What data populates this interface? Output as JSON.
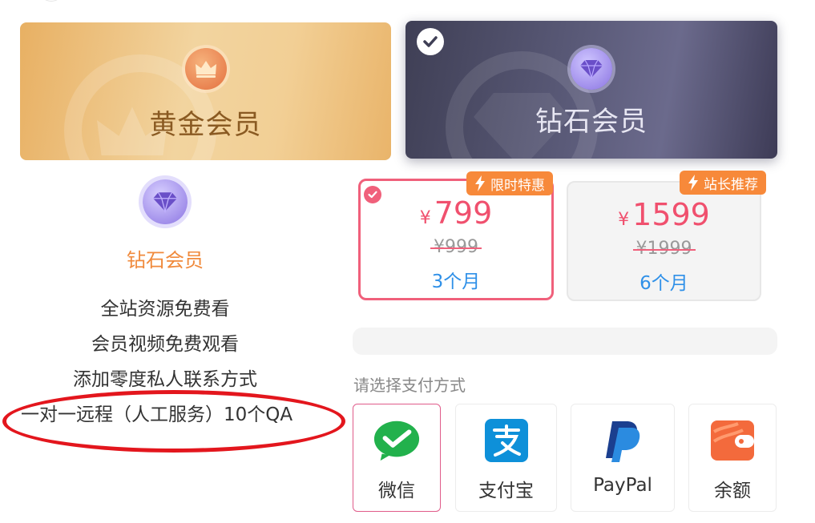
{
  "tiers": {
    "gold": {
      "label": "黄金会员"
    },
    "diamond": {
      "label": "钻石会员",
      "selected": true
    }
  },
  "details": {
    "title": "钻石会员",
    "perks": [
      "全站资源免费看",
      "会员视频免费观看",
      "添加零度私人联系方式",
      "一对一远程（人工服务）10个QA"
    ]
  },
  "plans": [
    {
      "tag": "限时特惠",
      "currency": "¥",
      "price": "799",
      "original": "¥999",
      "period": "3个月",
      "selected": true
    },
    {
      "tag": "站长推荐",
      "currency": "¥",
      "price": "1599",
      "original": "¥1999",
      "period": "6个月",
      "selected": false
    }
  ],
  "payment": {
    "label": "请选择支付方式",
    "methods": [
      {
        "name": "微信",
        "icon": "wechat-pay-icon",
        "selected": true
      },
      {
        "name": "支付宝",
        "icon": "alipay-icon",
        "selected": false
      },
      {
        "name": "PayPal",
        "icon": "paypal-icon",
        "selected": false
      },
      {
        "name": "余额",
        "icon": "wallet-balance-icon",
        "selected": false
      }
    ]
  },
  "colors": {
    "accent_pink": "#f0607b",
    "tag_orange": "#f7893a",
    "period_blue": "#2f90e8",
    "annotation_red": "#e3161d"
  }
}
